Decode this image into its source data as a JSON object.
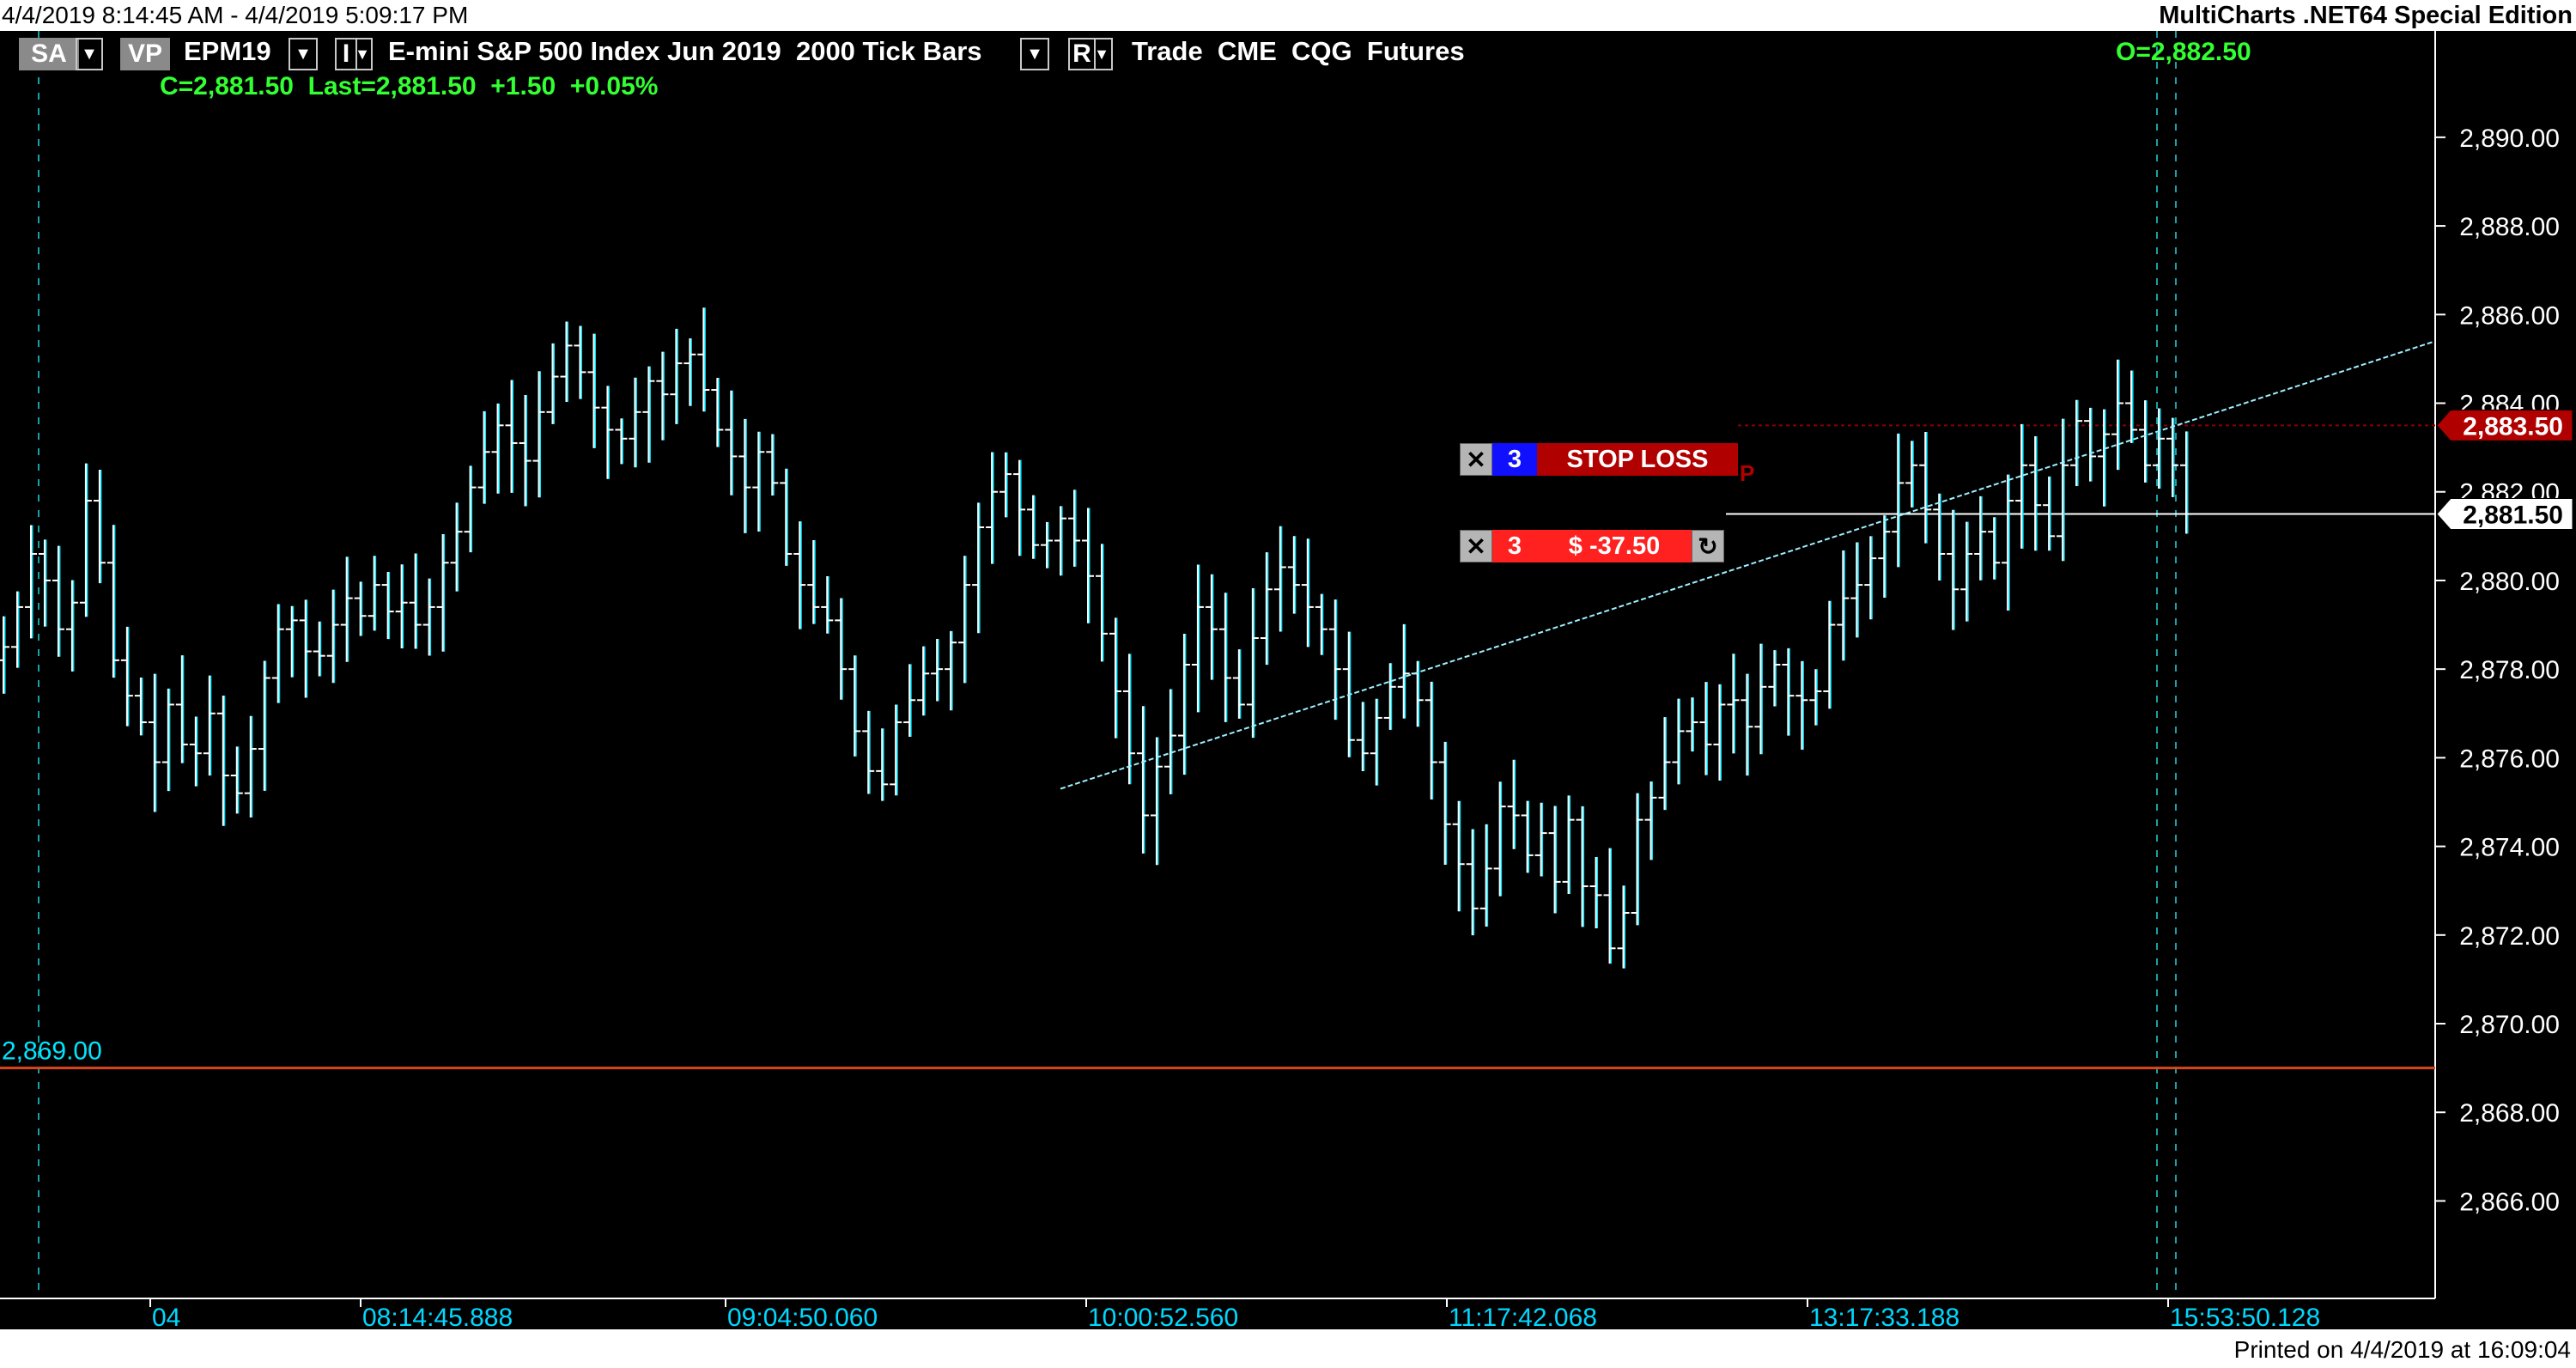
{
  "window": {
    "date_range": "4/4/2019 8:14:45 AM - 4/4/2019 5:09:17 PM",
    "edition": "MultiCharts .NET64 Special Edition",
    "printed": "Printed on 4/4/2019 at 16:09:04"
  },
  "header": {
    "sa": "SA",
    "vp": "VP",
    "symbol": "EPM19",
    "interval_btn": "I",
    "description": "E-mini S&P 500 Index Jun 2019  2000 Tick Bars",
    "r_btn": "R",
    "trade_info": "Trade  CME  CQG  Futures",
    "quote": "C=2,881.50  Last=2,881.50  +1.50  +0.05%",
    "open": "O=2,882.50",
    "dropdown_glyph": "▼"
  },
  "orders": {
    "stop": {
      "close": "✕",
      "qty": "3",
      "label": "STOP LOSS",
      "flag": "P"
    },
    "position": {
      "close": "✕",
      "qty": "3",
      "label": "$ -37.50",
      "reverse_icon": "↻"
    }
  },
  "colors": {
    "background": "#000000",
    "bars": "#ffffff",
    "bar_edge": "#00e5ff",
    "axis_text": "#ffffff",
    "time_text": "#00d8ff",
    "support_line": "#d8461a",
    "stop_line": "#8b0000",
    "position_line": "#ffffff",
    "trendline": "#9ef0ff",
    "stop_red": "#b00000",
    "pnl_red": "#ff2020",
    "qty_blue": "#1010ff"
  },
  "chart_data": {
    "type": "bar",
    "subtype": "OHLC tick bars",
    "y_axis_ticks": [
      "2,890.00",
      "2,888.00",
      "2,886.00",
      "2,884.00",
      "2,882.00",
      "2,880.00",
      "2,878.00",
      "2,876.00",
      "2,874.00",
      "2,872.00",
      "2,870.00",
      "2,868.00",
      "2,866.00"
    ],
    "y_axis_ticks_values": [
      2890,
      2888,
      2886,
      2884,
      2882,
      2880,
      2878,
      2876,
      2874,
      2872,
      2870,
      2868,
      2866
    ],
    "ylim": [
      2863.8,
      2892.4
    ],
    "x_tick_labels": [
      "04",
      "08:14:45.888",
      "09:04:50.060",
      "10:00:52.560",
      "11:17:42.068",
      "13:17:33.188",
      "15:53:50.128"
    ],
    "price_markers": {
      "stop_loss": {
        "value": 2883.5,
        "label": "2,883.50"
      },
      "last": {
        "value": 2881.5,
        "label": "2,881.50"
      },
      "support": {
        "value": 2869.0,
        "label": "2,869.00"
      }
    },
    "trendline": {
      "start_bar": 77,
      "start_price": 2875.3,
      "end_price": 2885.4
    },
    "close_path": [
      2878.5,
      2879.4,
      2880.6,
      2880.0,
      2878.9,
      2879.5,
      2881.8,
      2880.4,
      2878.2,
      2877.4,
      2876.8,
      2875.9,
      2877.2,
      2876.3,
      2876.1,
      2877.0,
      2875.6,
      2875.2,
      2876.2,
      2877.8,
      2878.9,
      2879.1,
      2878.4,
      2878.3,
      2879.0,
      2879.6,
      2879.2,
      2879.9,
      2879.3,
      2879.5,
      2879.0,
      2879.4,
      2880.4,
      2881.1,
      2882.1,
      2882.9,
      2883.5,
      2883.1,
      2882.7,
      2883.8,
      2884.6,
      2885.3,
      2884.7,
      2883.9,
      2883.4,
      2883.2,
      2883.8,
      2884.5,
      2884.2,
      2884.9,
      2885.1,
      2884.3,
      2883.4,
      2882.8,
      2882.1,
      2882.9,
      2882.2,
      2880.6,
      2879.9,
      2879.4,
      2879.1,
      2878.0,
      2876.6,
      2875.7,
      2875.4,
      2876.8,
      2877.3,
      2877.9,
      2878.0,
      2878.6,
      2879.9,
      2881.2,
      2882.0,
      2882.4,
      2881.6,
      2880.8,
      2880.9,
      2881.4,
      2880.9,
      2880.1,
      2878.8,
      2877.5,
      2876.1,
      2874.7,
      2875.8,
      2876.5,
      2878.1,
      2879.4,
      2878.9,
      2877.8,
      2877.2,
      2878.7,
      2879.8,
      2880.3,
      2879.9,
      2879.4,
      2878.9,
      2878.0,
      2876.4,
      2876.1,
      2876.9,
      2877.6,
      2877.9,
      2877.3,
      2875.9,
      2874.5,
      2873.6,
      2872.6,
      2873.5,
      2874.9,
      2874.7,
      2873.8,
      2874.3,
      2873.2,
      2874.6,
      2873.1,
      2872.9,
      2871.7,
      2872.5,
      2874.6,
      2875.1,
      2875.9,
      2876.6,
      2876.8,
      2876.3,
      2877.2,
      2877.3,
      2876.7,
      2877.6,
      2878.1,
      2877.4,
      2877.3,
      2877.5,
      2879.0,
      2879.6,
      2879.9,
      2880.5,
      2881.1,
      2882.2,
      2882.6,
      2881.6,
      2880.6,
      2879.8,
      2880.6,
      2881.1,
      2880.4,
      2881.8,
      2882.6,
      2881.7,
      2881.0,
      2882.6,
      2883.6,
      2882.8,
      2883.3,
      2884.0,
      2883.4,
      2882.6,
      2883.2,
      2882.6,
      2881.5
    ]
  }
}
